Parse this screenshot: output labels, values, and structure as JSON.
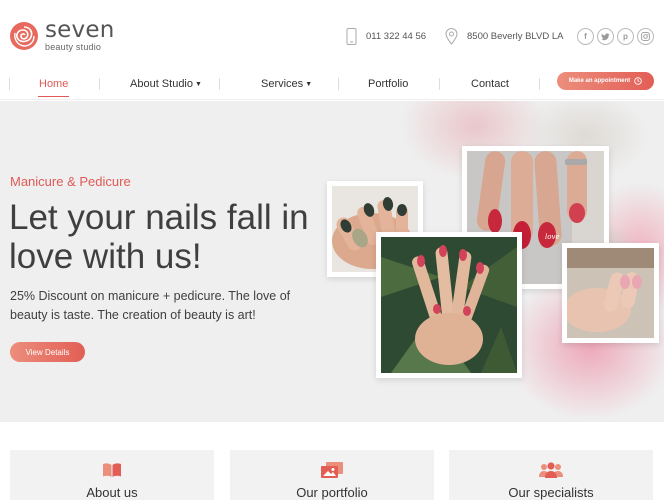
{
  "brand": {
    "name": "seven",
    "tagline": "beauty studio"
  },
  "contact": {
    "phone": "011 322 44 56",
    "address": "8500 Beverly BLVD LA"
  },
  "socials": [
    "facebook",
    "twitter",
    "pinterest",
    "instagram"
  ],
  "nav": {
    "items": [
      {
        "label": "Home",
        "active": true
      },
      {
        "label": "About Studio",
        "dropdown": true
      },
      {
        "label": "Services",
        "dropdown": true
      },
      {
        "label": "Portfolio"
      },
      {
        "label": "Contact"
      }
    ],
    "appointment_label": "Make an appointment"
  },
  "hero": {
    "kicker": "Manicure & Pedicure",
    "headline": "Let your nails fall in love with us!",
    "subtext": "25% Discount on manicure + pedicure. The love of beauty is taste. The creation of beauty is art!",
    "cta_label": "View Details"
  },
  "features": [
    {
      "title": "About us",
      "icon": "book-icon"
    },
    {
      "title": "Our portfolio",
      "icon": "gallery-icon"
    },
    {
      "title": "Our specialists",
      "icon": "people-icon"
    }
  ],
  "colors": {
    "accent": "#e05a55",
    "accent_light": "#ec8e7c",
    "hero_bg": "#efefef",
    "card_bg": "#f2f2f2"
  }
}
